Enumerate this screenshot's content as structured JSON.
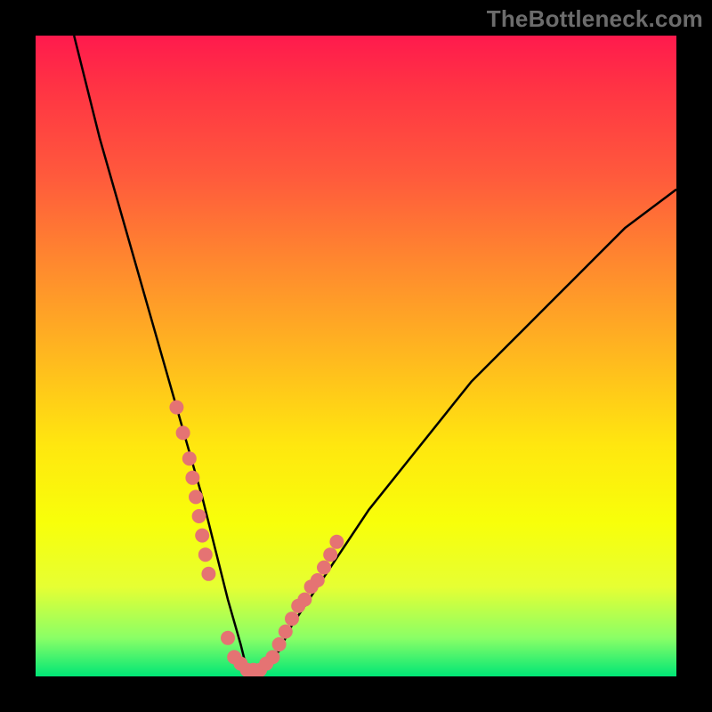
{
  "watermark": "TheBottleneck.com",
  "chart_data": {
    "type": "line",
    "title": "",
    "xlabel": "",
    "ylabel": "",
    "xlim": [
      0,
      100
    ],
    "ylim": [
      0,
      100
    ],
    "grid": false,
    "curve_x": [
      6,
      8,
      10,
      12,
      14,
      16,
      18,
      20,
      22,
      24,
      26,
      28,
      30,
      32,
      33,
      34,
      36,
      38,
      40,
      44,
      48,
      52,
      56,
      60,
      64,
      68,
      72,
      76,
      80,
      84,
      88,
      92,
      96,
      100
    ],
    "curve_y": [
      100,
      92,
      84,
      77,
      70,
      63,
      56,
      49,
      42,
      35,
      28,
      20,
      12,
      5,
      1,
      1,
      2,
      4,
      8,
      14,
      20,
      26,
      31,
      36,
      41,
      46,
      50,
      54,
      58,
      62,
      66,
      70,
      73,
      76
    ],
    "markers_x": [
      22,
      23,
      24,
      24.5,
      25,
      25.5,
      26,
      26.5,
      27,
      30,
      31,
      32,
      33,
      34,
      35,
      36,
      37,
      38,
      39,
      40,
      41,
      42,
      43,
      44,
      45,
      46,
      47
    ],
    "markers_y": [
      42,
      38,
      34,
      31,
      28,
      25,
      22,
      19,
      16,
      6,
      3,
      2,
      1,
      1,
      1,
      2,
      3,
      5,
      7,
      9,
      11,
      12,
      14,
      15,
      17,
      19,
      21
    ],
    "marker_color": "#e57373",
    "curve_color": "#000000"
  }
}
